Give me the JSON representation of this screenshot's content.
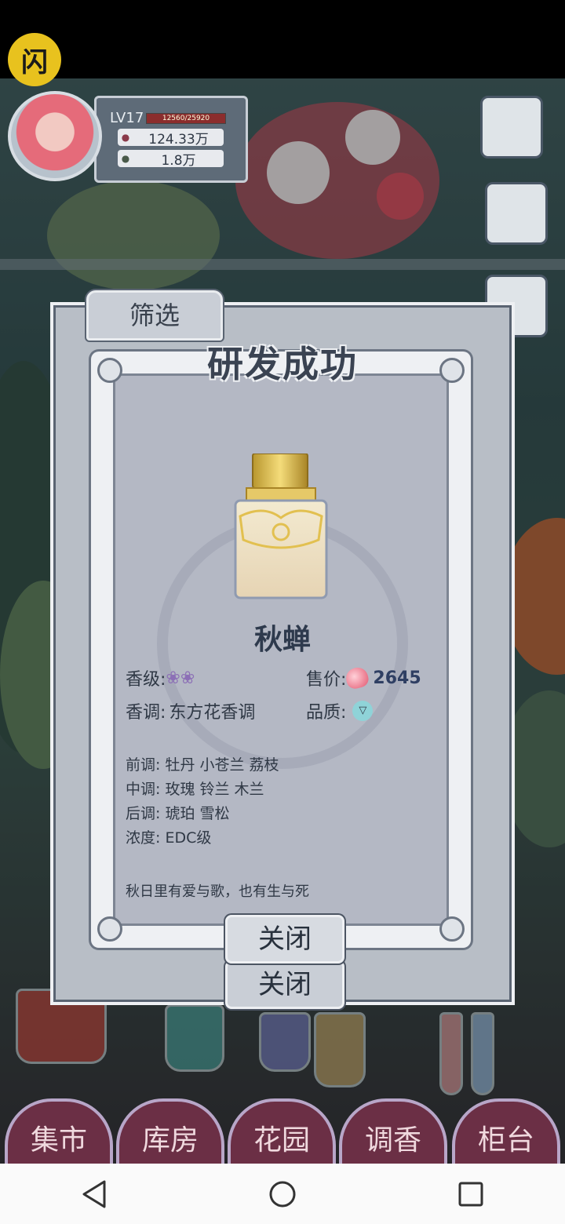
{
  "player": {
    "level": "LV17",
    "exp": "12560/25920",
    "currency1": "124.33万",
    "currency2": "1.8万"
  },
  "filter_tab": "筛选",
  "dialog": {
    "title": "研发成功",
    "perfume_name": "秋蝉",
    "grade_label": "香级:",
    "grade_icons": "❀❀",
    "price_label": "售价:",
    "price_value": "2645",
    "accord_label": "香调:",
    "accord_value": "东方花香调",
    "quality_label": "品质:",
    "notes": {
      "top": "前调:  牡丹 小苍兰 荔枝",
      "middle": "中调:  玫瑰 铃兰 木兰",
      "base": "后调:  琥珀 雪松",
      "concentration": "浓度:  EDC级"
    },
    "description": "秋日里有爱与歌，也有生与死",
    "close_label": "关闭"
  },
  "outer_close_label": "关闭",
  "flash_icon": "闪",
  "game_nav": [
    "集市",
    "库房",
    "花园",
    "调香",
    "柜台"
  ],
  "colors": {
    "panel": "#b4b8c4",
    "frame": "#eef0f3",
    "title_text": "#3a4352",
    "price_heart": "#e2566f",
    "quality_gem": "#8fd3d8"
  },
  "android_nav": [
    "back",
    "home",
    "recents"
  ]
}
